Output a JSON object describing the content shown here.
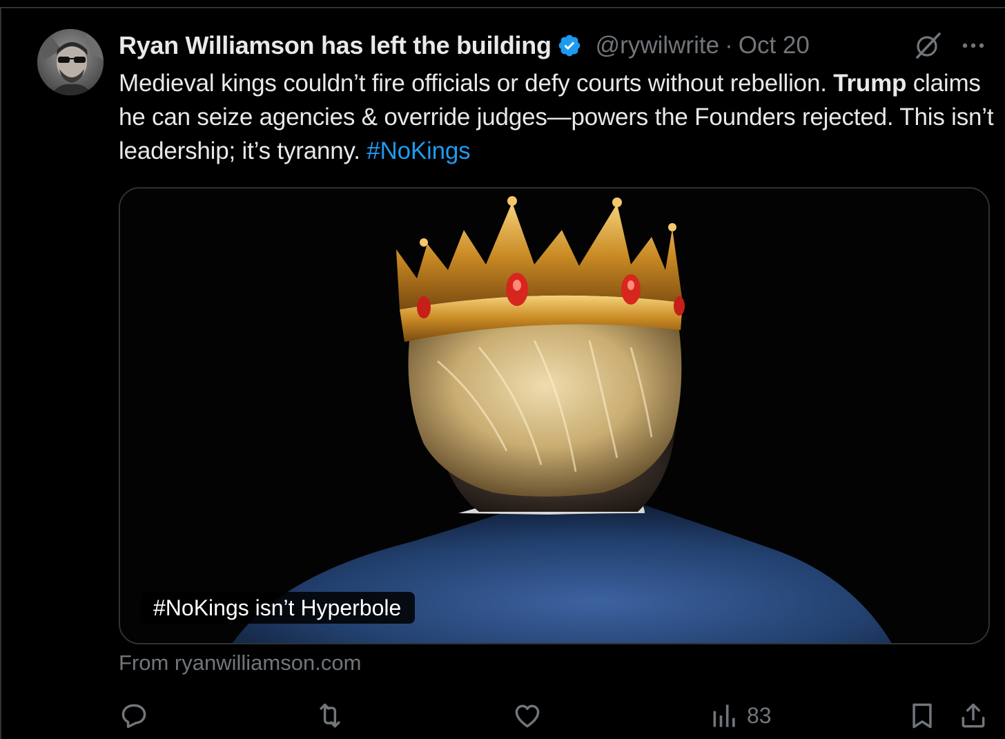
{
  "post": {
    "author": {
      "display_name": "Ryan Williamson has left the building",
      "handle": "@rywilwrite",
      "verified": true,
      "avatar_icon": "avatar-photo"
    },
    "separator": "·",
    "timestamp": "Oct 20",
    "text": {
      "part1": "Medieval kings couldn’t fire officials or defy courts without rebellion. ",
      "bold": "Trump",
      "part2": " claims he can seize agencies & override judges—powers the Founders rejected. This isn’t leadership; it’s tyranny. ",
      "hashtag": "#NoKings"
    },
    "media": {
      "caption": "#NoKings isn’t Hyperbole"
    },
    "source": "From ryanwilliamson.com",
    "actions": {
      "reply_icon": "reply-icon",
      "repost_icon": "repost-icon",
      "like_icon": "heart-icon",
      "views_icon": "views-icon",
      "views_count": "83",
      "bookmark_icon": "bookmark-icon",
      "share_icon": "share-icon"
    }
  },
  "colors": {
    "background": "#000000",
    "text_primary": "#e7e9ea",
    "text_secondary": "#71767b",
    "accent": "#1d9bf0",
    "border": "#2f3336"
  }
}
